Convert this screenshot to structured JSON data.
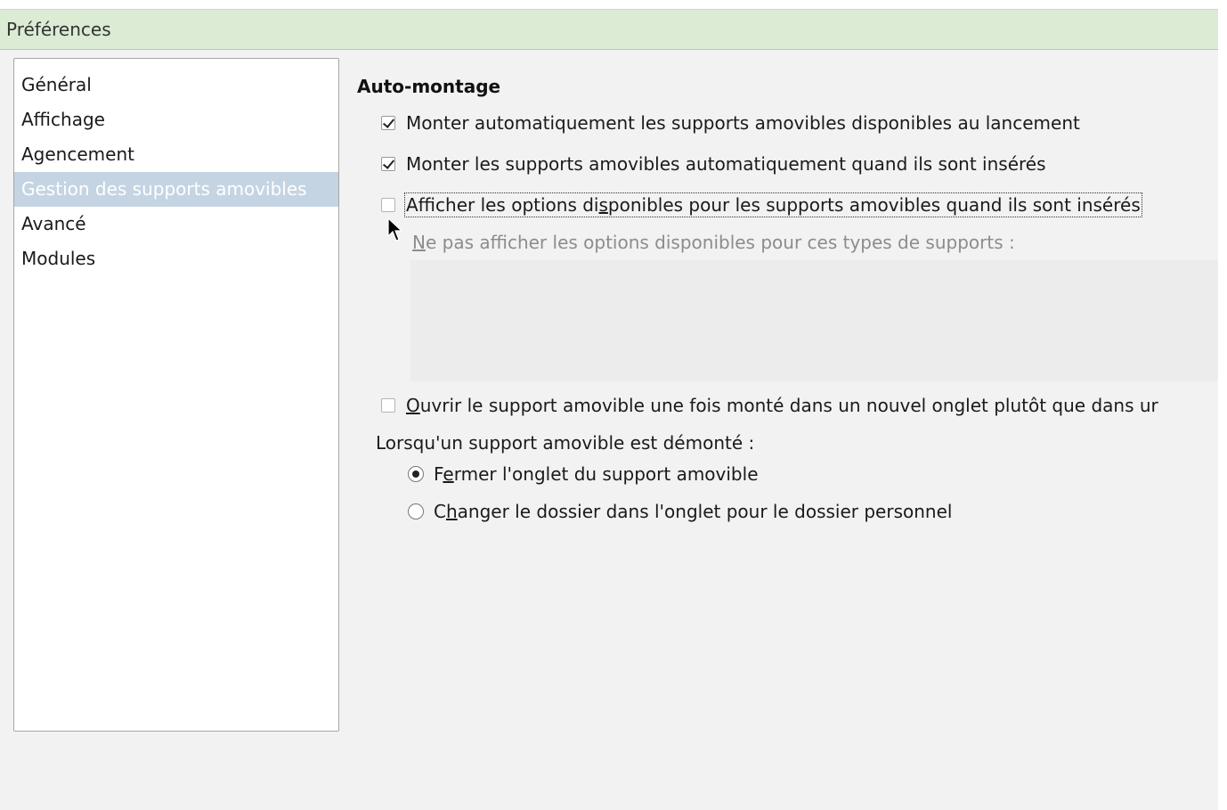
{
  "window": {
    "title": "Préférences"
  },
  "sidebar": {
    "items": [
      {
        "label": "Général",
        "selected": false
      },
      {
        "label": "Affichage",
        "selected": false
      },
      {
        "label": "Agencement",
        "selected": false
      },
      {
        "label": "Gestion des supports amovibles",
        "selected": true
      },
      {
        "label": "Avancé",
        "selected": false
      },
      {
        "label": "Modules",
        "selected": false
      }
    ]
  },
  "main": {
    "section_title": "Auto-montage",
    "options": {
      "mount_at_launch": {
        "label": "Monter automatiquement les supports amovibles disponibles au lancement",
        "checked": true
      },
      "mount_on_insert": {
        "label": "Monter les supports amovibles automatiquement quand ils sont insérés",
        "checked": true
      },
      "show_options": {
        "label_a": "Afficher les options di",
        "label_u": "s",
        "label_b": "ponibles pour les supports amovibles quand ils sont insérés",
        "checked": false
      },
      "hide_for_types_label": {
        "u": "N",
        "rest": "e pas afficher les options disponibles pour ces types de supports :"
      },
      "open_new_tab": {
        "label_u": "O",
        "label_rest": "uvrir le support amovible une fois monté dans un nouvel onglet plutôt que dans ur",
        "checked": false
      }
    },
    "unmount_label": "Lorsqu'un support amovible est démonté :",
    "unmount_choices": {
      "close_tab": {
        "a": "F",
        "u": "e",
        "b": "rmer l'onglet du support amovible",
        "selected": true
      },
      "change_folder": {
        "a": "C",
        "u": "h",
        "b": "anger le dossier dans l'onglet pour le dossier personnel",
        "selected": false
      }
    }
  },
  "colors": {
    "titlebar_bg": "#dbebd4",
    "selection_bg": "#c4d4e3",
    "content_bg": "#f2f2f2"
  }
}
